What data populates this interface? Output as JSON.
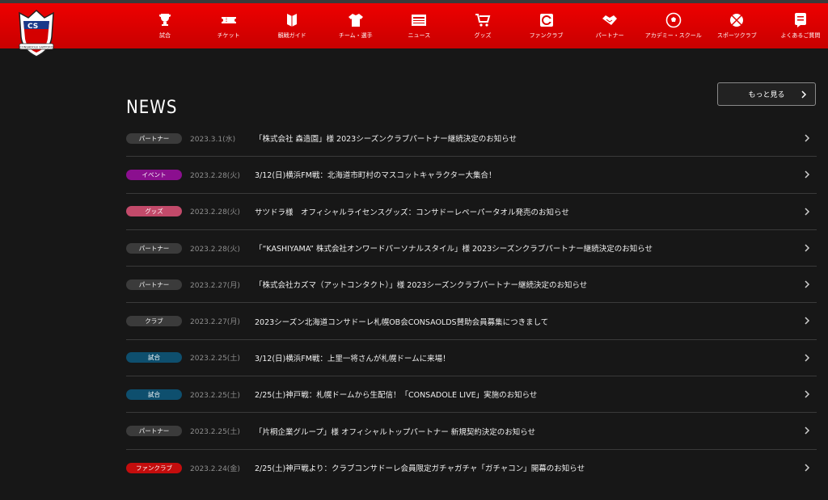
{
  "header": {
    "logo": {
      "text": "CONSADOLE SAPPORO",
      "mark": "CS"
    },
    "nav": [
      {
        "label": "試合",
        "icon": "trophy-icon"
      },
      {
        "label": "チケット",
        "icon": "ticket-icon"
      },
      {
        "label": "観戦ガイド",
        "icon": "guide-book-icon"
      },
      {
        "label": "チーム・選手",
        "icon": "jersey-icon"
      },
      {
        "label": "ニュース",
        "icon": "news-icon"
      },
      {
        "label": "グッズ",
        "icon": "cart-icon"
      },
      {
        "label": "ファンクラブ",
        "icon": "fanclub-card-icon"
      },
      {
        "label": "パートナー",
        "icon": "handshake-icon"
      },
      {
        "label": "アカデミー・スクール",
        "icon": "soccer-ball-icon"
      },
      {
        "label": "スポーツクラブ",
        "icon": "sports-club-icon"
      },
      {
        "label": "よくあるご質問",
        "icon": "faq-icon"
      }
    ]
  },
  "main": {
    "title": "NEWS",
    "more_label": "もっと見る",
    "news": [
      {
        "category": "パートナー",
        "color": "#3b3b3b",
        "date": "2023.3.1(水)",
        "title": "「株式会社 森造園」様 2023シーズンクラブパートナー継続決定のお知らせ"
      },
      {
        "category": "イベント",
        "color": "#8b0f8f",
        "date": "2023.2.28(火)",
        "title": "3/12(日)横浜FM戦：北海道市町村のマスコットキャラクター大集合！"
      },
      {
        "category": "グッズ",
        "color": "#c24a6a",
        "date": "2023.2.28(火)",
        "title": "サツドラ様　オフィシャルライセンスグッズ：コンサドーレペーパータオル発売のお知らせ"
      },
      {
        "category": "パートナー",
        "color": "#3b3b3b",
        "date": "2023.2.28(火)",
        "title": "「“KASHIYAMA” 株式会社オンワードパーソナルスタイル」様 2023シーズンクラブパートナー継続決定のお知らせ"
      },
      {
        "category": "パートナー",
        "color": "#3b3b3b",
        "date": "2023.2.27(月)",
        "title": "「株式会社カズマ（アットコンタクト）」様 2023シーズンクラブパートナー継続決定のお知らせ"
      },
      {
        "category": "クラブ",
        "color": "#3b3b3b",
        "date": "2023.2.27(月)",
        "title": "2023シーズン北海道コンサドーレ札幌OB会CONSAOLDS賛助会員募集につきまして"
      },
      {
        "category": "試合",
        "color": "#0e4f6e",
        "date": "2023.2.25(土)",
        "title": "3/12(日)横浜FM戦：上里一将さんが札幌ドームに来場！"
      },
      {
        "category": "試合",
        "color": "#0e4f6e",
        "date": "2023.2.25(土)",
        "title": "2/25(土)神戸戦：札幌ドームから生配信！「CONSADOLE LIVE」実施のお知らせ"
      },
      {
        "category": "パートナー",
        "color": "#3b3b3b",
        "date": "2023.2.25(土)",
        "title": "「片桐企業グループ」様 オフィシャルトップパートナー 新規契約決定のお知らせ"
      },
      {
        "category": "ファンクラブ",
        "color": "#c40d0d",
        "date": "2023.2.24(金)",
        "title": "2/25(土)神戸戦より：クラブコンサドーレ会員限定ガチャガチャ「ガチャコン」開幕のお知らせ"
      }
    ]
  }
}
